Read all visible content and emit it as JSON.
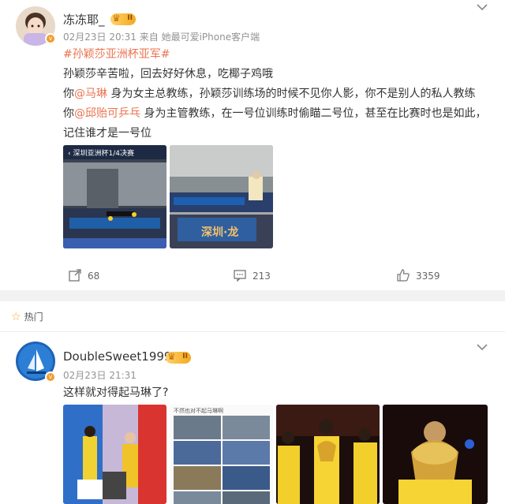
{
  "post1": {
    "username": "冻冻耶_",
    "vip_level": "II",
    "meta": "02月23日 20:31  来自 她最可爱iPhone客户端",
    "hashtag": "#孙颖莎亚洲杯亚军#",
    "line1": "孙颖莎辛苦啦，回去好好休息，吃椰子鸡哦",
    "line2_prefix": "你",
    "line2_mention": "@马琳",
    "line2_rest": " 身为女主总教练，孙颖莎训练场的时候不见你人影，你不是别人的私人教练",
    "line3_prefix": "你",
    "line3_mention": "@邱贻可乒乓",
    "line3_rest": " 身为主管教练，在一号位训练时偷瞄二号位，甚至在比赛时也是如此，",
    "line4": "记住谁才是一号位",
    "image1_caption": "深圳亚洲杯1/4决赛",
    "image2_banner": "深圳·龙",
    "repost_count": "68",
    "comment_count": "213",
    "like_count": "3359"
  },
  "section": {
    "hot_label": "热门"
  },
  "post2": {
    "username": "DoubleSweet1999",
    "vip_level": "II",
    "meta": "02月23日 21:31",
    "text": "这样就对得起马琳了?",
    "image2_caption": "不然也对不起马琳啊"
  },
  "icons": {
    "more": "chevron-down-icon",
    "repost": "share-icon",
    "comment": "comment-icon",
    "like": "thumbs-up-icon",
    "hot": "star-icon"
  },
  "colors": {
    "accent": "#eb7350",
    "vip_gold": "#f4a81d",
    "meta_gray": "#939393"
  }
}
